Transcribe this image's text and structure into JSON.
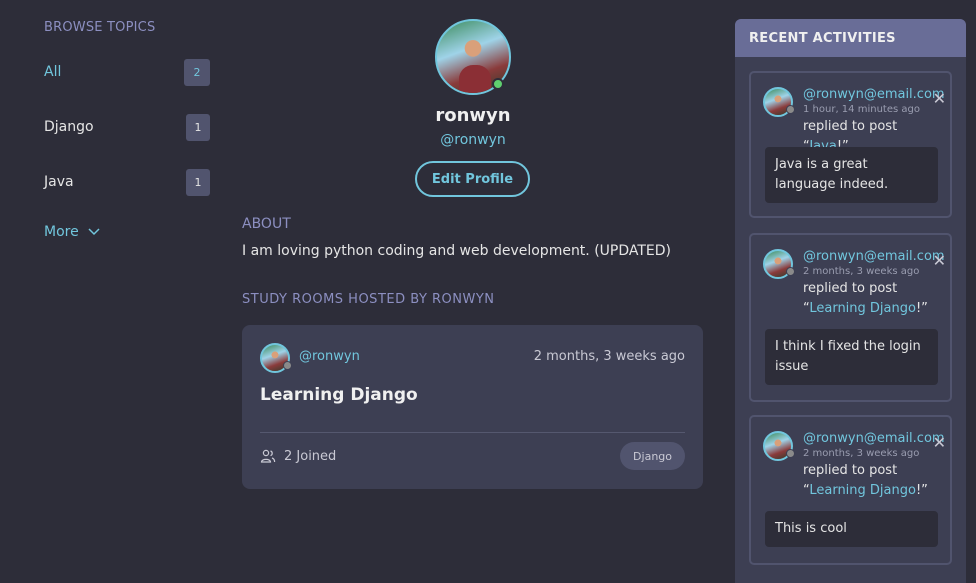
{
  "topics": {
    "title": "BROWSE TOPICS",
    "items": [
      {
        "label": "All",
        "count": "2"
      },
      {
        "label": "Django",
        "count": "1"
      },
      {
        "label": "Java",
        "count": "1"
      }
    ],
    "more_label": "More"
  },
  "profile": {
    "name": "ronwyn",
    "handle": "@ronwyn",
    "edit_label": "Edit Profile",
    "about_title": "ABOUT",
    "about_text": "I am loving python coding and web development. (UPDATED)",
    "rooms_title": "STUDY ROOMS HOSTED BY RONWYN"
  },
  "room": {
    "host": "@ronwyn",
    "time": "2 months, 3 weeks ago",
    "name": "Learning Django",
    "joined": "2 Joined",
    "tag": "Django"
  },
  "activities": {
    "title": "RECENT ACTIVITIES",
    "items": [
      {
        "user": "@ronwyn@email.com",
        "time": "1 hour, 14 minutes ago",
        "action": "replied to post “",
        "post": "Java",
        "suffix": "!”",
        "body": "Java is a great language indeed."
      },
      {
        "user": "@ronwyn@email.com",
        "time": "2 months, 3 weeks ago",
        "action": "replied to post “",
        "post": "Learning Django",
        "suffix": "!”",
        "body": "I think I fixed the login issue"
      },
      {
        "user": "@ronwyn@email.com",
        "time": "2 months, 3 weeks ago",
        "action": "replied to post “",
        "post": "Learning Django",
        "suffix": "!”",
        "body": "This is cool"
      }
    ]
  },
  "colors": {
    "accent": "#71c6dd",
    "background": "#2d2d39",
    "card": "#3d3f53",
    "header": "#696d97"
  }
}
